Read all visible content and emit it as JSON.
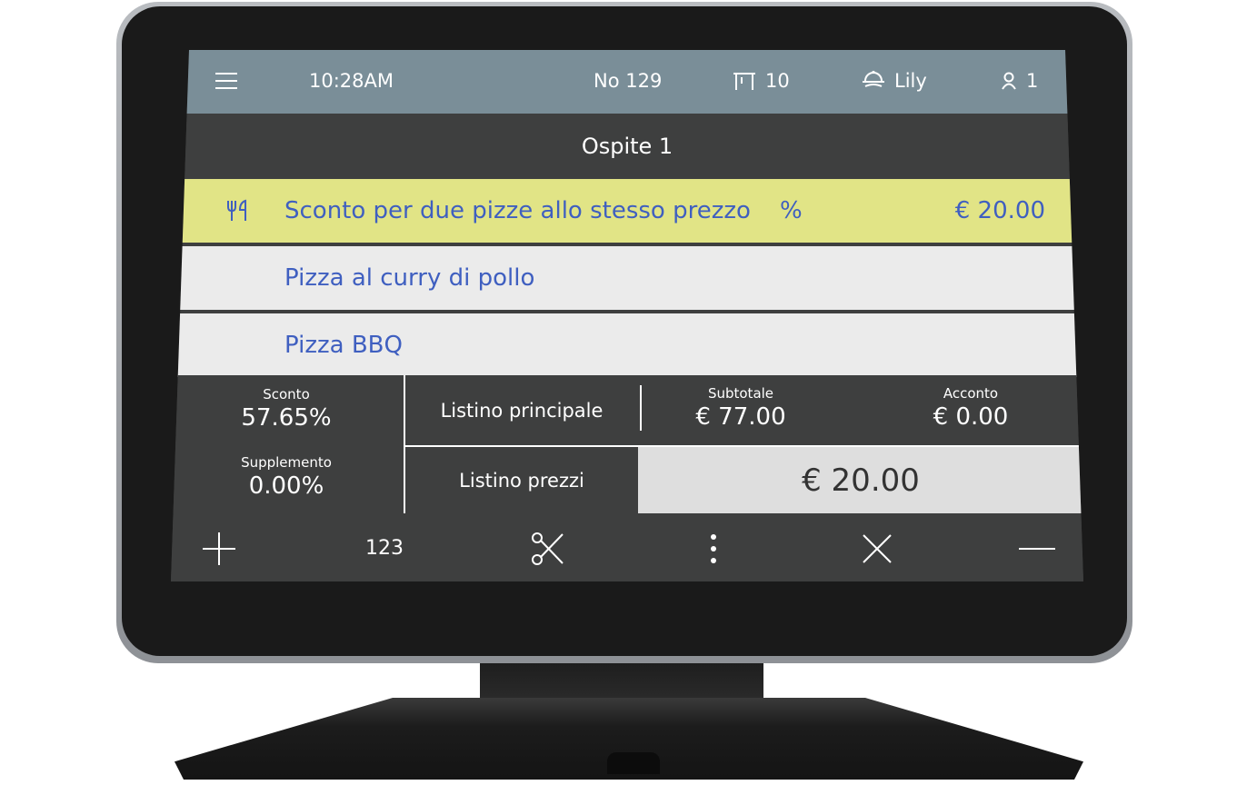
{
  "topbar": {
    "menu_icon": "hamburger-menu-icon",
    "time": "10:28AM",
    "order_number": "No 129",
    "table_icon": "table-icon",
    "table_number": "10",
    "waiter_icon": "waiter-icon",
    "waiter_name": "Lily",
    "guest_icon": "person-icon",
    "guest_count": "1"
  },
  "guest_header": "Ospite 1",
  "order_items": [
    {
      "name": "Sconto per due pizze allo stesso prezzo",
      "badge": "%",
      "price": "€ 20.00",
      "icon": "fork-knife-icon",
      "highlight_color": "#e1e486"
    },
    {
      "name": "Pizza al curry di pollo",
      "badge": "",
      "price": ""
    },
    {
      "name": "Pizza BBQ",
      "badge": "",
      "price": ""
    }
  ],
  "summary": {
    "discount_label": "Sconto",
    "discount_value": "57.65%",
    "surcharge_label": "Supplemento",
    "surcharge_value": "0.00%",
    "main_pricelist_button": "Listino principale",
    "pricelist_button": "Listino prezzi",
    "subtotal_label": "Subtotale",
    "subtotal_value": "€ 77.00",
    "deposit_label": "Acconto",
    "deposit_value": "€ 0.00",
    "total": "€ 20.00"
  },
  "toolbar": {
    "add_icon": "plus-icon",
    "numpad_label": "123",
    "split_icon": "scissors-icon",
    "more_icon": "more-vertical-icon",
    "remove_icon": "close-icon",
    "minus_icon": "minus-icon"
  },
  "colors": {
    "topbar": "#7a8e98",
    "panel": "#3e3f3f",
    "highlight": "#e1e486",
    "item_text": "#3f5fc0"
  }
}
